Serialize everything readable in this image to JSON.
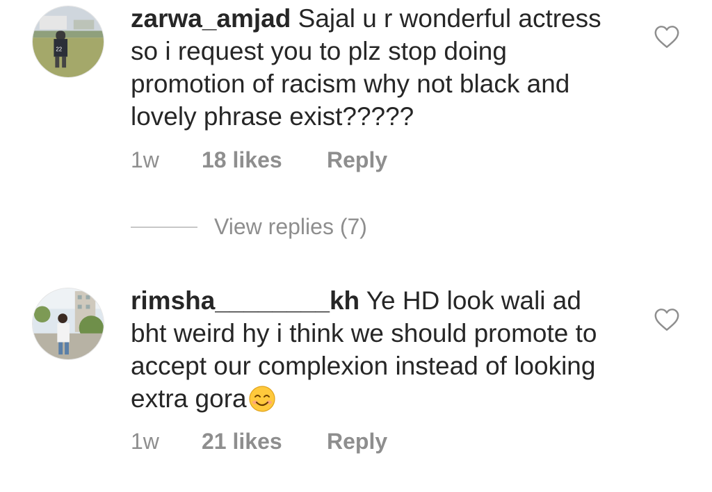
{
  "comments": [
    {
      "username": "zarwa_amjad",
      "text": " Sajal u r wonderful actress so i request you to plz stop doing promotion of racism why not black and lovely phrase exist?????",
      "time": "1w",
      "likes": "18 likes",
      "reply_label": "Reply"
    },
    {
      "username": "rimsha________kh",
      "text": " Ye HD look wali ad bht weird hy i think we should promote to accept our complexion instead of looking extra gora",
      "emoji": "smiling-face-emoji",
      "time": "1w",
      "likes": "21 likes",
      "reply_label": "Reply"
    }
  ],
  "view_replies": "View replies (7)",
  "icons": {
    "like": "heart-outline-icon"
  },
  "colors": {
    "text": "#262626",
    "secondary": "#8e8e8e",
    "divider": "#c7c7c7"
  }
}
